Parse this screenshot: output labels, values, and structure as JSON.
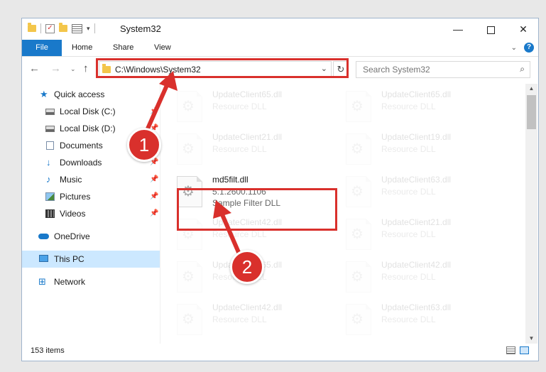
{
  "window": {
    "title": "System32",
    "controls": {
      "minimize": "—",
      "maximize": "",
      "close": "✕"
    }
  },
  "quick_access_toolbar": {
    "dropdown": "▾"
  },
  "ribbon": {
    "tabs": [
      {
        "label": "File",
        "active": true
      },
      {
        "label": "Home"
      },
      {
        "label": "Share"
      },
      {
        "label": "View"
      }
    ],
    "expand_chevron": "⌄",
    "help": "?"
  },
  "navigation": {
    "back": "←",
    "forward": "→",
    "recent": "⌄",
    "up": "↑",
    "address_path": "C:\\Windows\\System32",
    "address_dropdown": "⌄",
    "refresh": "↻",
    "search_placeholder": "Search System32",
    "search_icon": "⌕"
  },
  "sidebar": {
    "items": [
      {
        "label": "Quick access",
        "icon": "star-icon"
      },
      {
        "label": "Local Disk (C:)",
        "icon": "drive-icon",
        "pinned": true
      },
      {
        "label": "Local Disk (D:)",
        "icon": "drive-icon",
        "pinned": true
      },
      {
        "label": "Documents",
        "icon": "document-icon",
        "pinned": true
      },
      {
        "label": "Downloads",
        "icon": "download-icon",
        "pinned": true
      },
      {
        "label": "Music",
        "icon": "music-icon",
        "pinned": true
      },
      {
        "label": "Pictures",
        "icon": "pictures-icon",
        "pinned": true
      },
      {
        "label": "Videos",
        "icon": "video-icon",
        "pinned": true
      },
      {
        "label": "OneDrive",
        "icon": "cloud-icon"
      },
      {
        "label": "This PC",
        "icon": "computer-icon",
        "selected": true
      },
      {
        "label": "Network",
        "icon": "network-icon"
      }
    ],
    "pin_glyph": "📌"
  },
  "files": [
    {
      "name": "UpdateClient65.dll",
      "type": "Resource DLL"
    },
    {
      "name": "UpdateClient65.dll",
      "type": "Resource DLL"
    },
    {
      "name": "UpdateClient21.dll",
      "type": "Resource DLL"
    },
    {
      "name": "UpdateClient19.dll",
      "type": "Resource DLL"
    },
    {
      "name": "md5filt.dll",
      "version": "5.1.2600.1106",
      "type": "Sample Filter DLL",
      "highlighted": true
    },
    {
      "name": "UpdateClient63.dll",
      "type": "Resource DLL"
    },
    {
      "name": "UpdateClient42.dll",
      "type": "Resource DLL"
    },
    {
      "name": "UpdateClient21.dll",
      "type": "Resource DLL"
    },
    {
      "name": "UpdateClient65.dll",
      "type": "Resource DLL"
    },
    {
      "name": "UpdateClient42.dll",
      "type": "Resource DLL"
    },
    {
      "name": "UpdateClient42.dll",
      "type": "Resource DLL"
    },
    {
      "name": "UpdateClient63.dll",
      "type": "Resource DLL"
    }
  ],
  "scrollbar": {
    "up": "▲",
    "down": "▼"
  },
  "status": {
    "item_count": "153 items"
  },
  "callouts": [
    {
      "number": "1"
    },
    {
      "number": "2"
    }
  ],
  "colors": {
    "accent": "#1979ca",
    "highlight": "#d9302c",
    "selection": "#cce8ff"
  }
}
